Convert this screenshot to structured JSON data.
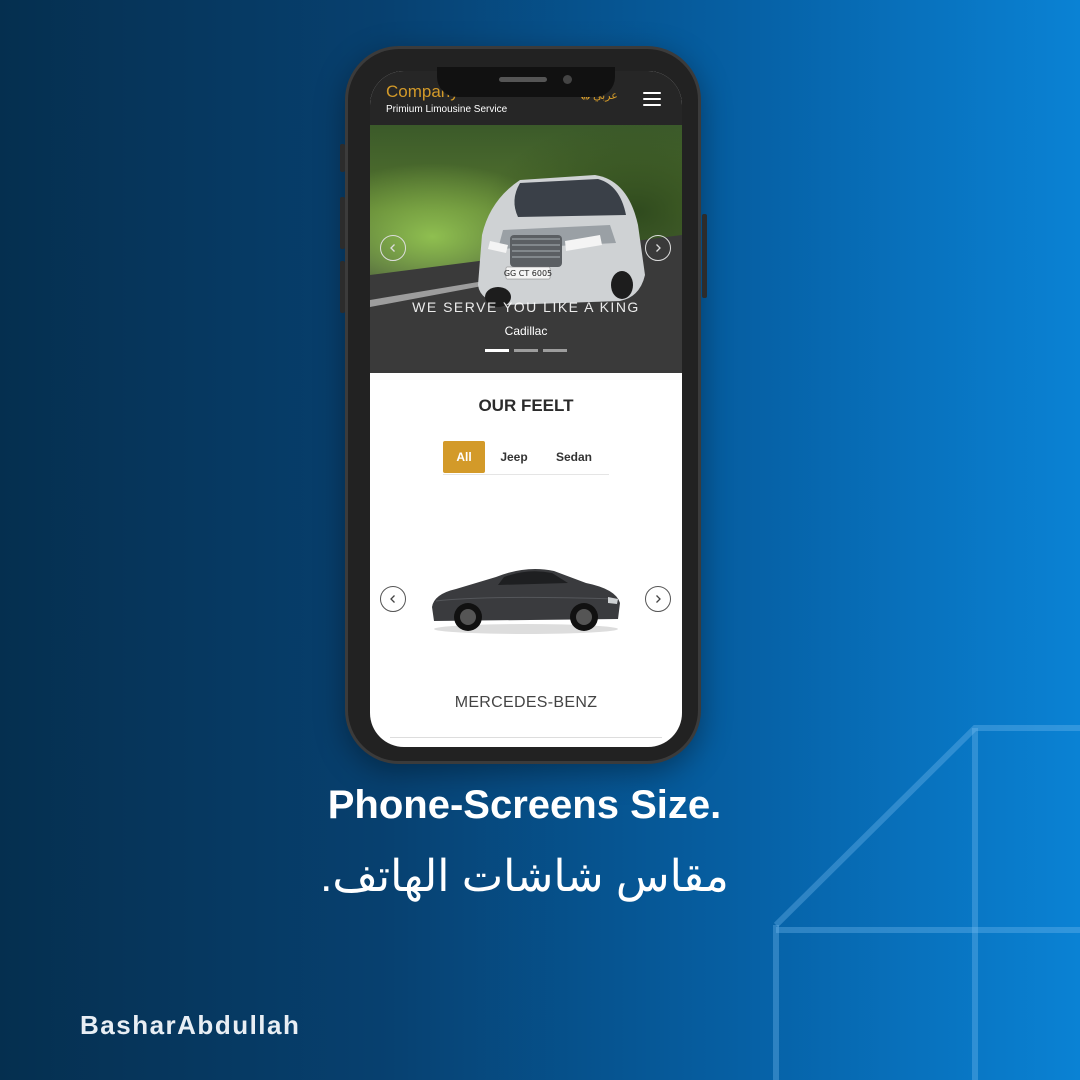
{
  "app": {
    "company_name": "Company name",
    "tagline": "Primium Limousine Service",
    "language_label": "عربي",
    "hero": {
      "slogan": "WE SERVE YOU LIKE A KING",
      "subtitle": "Cadillac",
      "plate": "GG CT 6005",
      "slide_count": 3,
      "active_slide": 1
    },
    "fleet": {
      "title": "OUR FEELT",
      "tabs": [
        {
          "label": "All",
          "active": true
        },
        {
          "label": "Jeep",
          "active": false
        },
        {
          "label": "Sedan",
          "active": false
        }
      ],
      "car_name": "MERCEDES-BENZ"
    }
  },
  "caption": {
    "english": "Phone-Screens Size.",
    "arabic": "مقاس شاشات الهاتف."
  },
  "brand": "BasharAbdullah",
  "colors": {
    "accent": "#d39a29",
    "header_bg": "#262626",
    "background_start": "#052f4f",
    "background_end": "#0a82d4"
  }
}
